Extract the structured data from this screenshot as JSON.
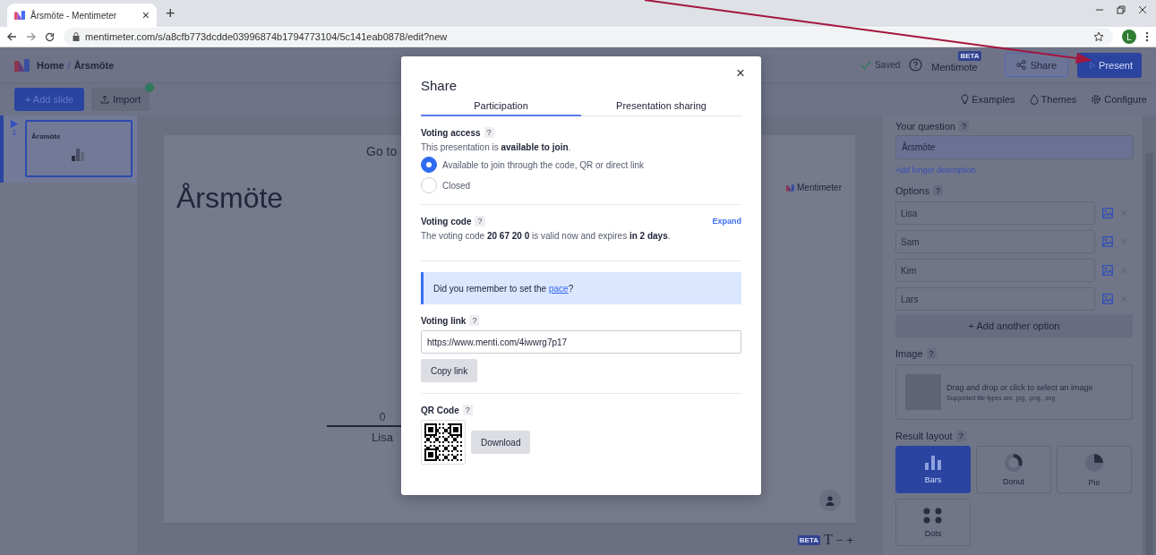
{
  "browser": {
    "tab_title": "Årsmöte - Mentimeter",
    "tab_close": "×",
    "new_tab": "+",
    "url": "mentimeter.com/s/a8cfb773dcdde03996874b1794773104/5c141eab0878/edit?new",
    "profile_initial": "L"
  },
  "header": {
    "home": "Home",
    "separator": "/",
    "current": "Årsmöte",
    "saved": "Saved",
    "mentimote": "Mentimote",
    "beta": "BETA",
    "share": "Share",
    "present": "Present"
  },
  "toolbar": {
    "add_slide": "+ Add slide",
    "import": "Import",
    "links": [
      {
        "kind": "bulb",
        "label": "Examples"
      },
      {
        "kind": "drop",
        "label": "Themes"
      },
      {
        "kind": "gear",
        "label": "Configure"
      }
    ]
  },
  "slides": [
    {
      "number": "1",
      "title": "Årsmöte",
      "selected": true
    }
  ],
  "canvas": {
    "instruction": "Go to",
    "title": "Årsmöte",
    "brand": "Mentimeter",
    "bar_value": "0",
    "bar_label": "Lisa"
  },
  "canvas_footer": {
    "beta": "BETA",
    "text_size": "T",
    "minus": "−",
    "plus": "+"
  },
  "modal": {
    "title": "Share",
    "close": "×",
    "tabs": [
      {
        "label": "Participation",
        "selected": true
      },
      {
        "label": "Presentation sharing",
        "selected": false
      }
    ],
    "voting_access": {
      "label": "Voting access",
      "help": "?",
      "status": "This presentation is **available to join**.",
      "options": [
        {
          "label": "Available to join through the code, QR or direct link",
          "selected": true
        },
        {
          "label": "Closed",
          "selected": false
        }
      ]
    },
    "voting_code": {
      "label": "Voting code",
      "help": "?",
      "expand": "Expand",
      "text": "The voting code **20 67 20 0** is valid now and expires **in 2 days**."
    },
    "tip": {
      "text": "Did you remember to set the ",
      "link": "pace",
      "end": "?"
    },
    "voting_link": {
      "label": "Voting link",
      "help": "?",
      "value": "https://www.menti.com/4iwwrg7p17",
      "copy": "Copy link"
    },
    "qr": {
      "label": "QR Code",
      "help": "?",
      "download": "Download"
    }
  },
  "panel": {
    "question": {
      "label": "Your question",
      "help": "?",
      "value": "Årsmöte",
      "add_description": "Add longer description"
    },
    "options": {
      "label": "Options",
      "help": "?",
      "items": [
        {
          "value": "Lisa"
        },
        {
          "value": "Sam"
        },
        {
          "value": "Kim"
        },
        {
          "value": "Lars"
        }
      ],
      "add": "+ Add another option"
    },
    "image": {
      "label": "Image",
      "help": "?",
      "drop_text": "Drag and drop or click to select an image",
      "types": "Supported file types are .jpg, .png, .svg"
    },
    "result_layout": {
      "label": "Result layout",
      "help": "?",
      "items": [
        {
          "kind": "bars",
          "label": "Bars",
          "selected": true
        },
        {
          "kind": "donut",
          "label": "Donut",
          "selected": false
        },
        {
          "kind": "pie",
          "label": "Pie",
          "selected": false
        },
        {
          "kind": "dots",
          "label": "Dots",
          "selected": false
        }
      ]
    }
  }
}
